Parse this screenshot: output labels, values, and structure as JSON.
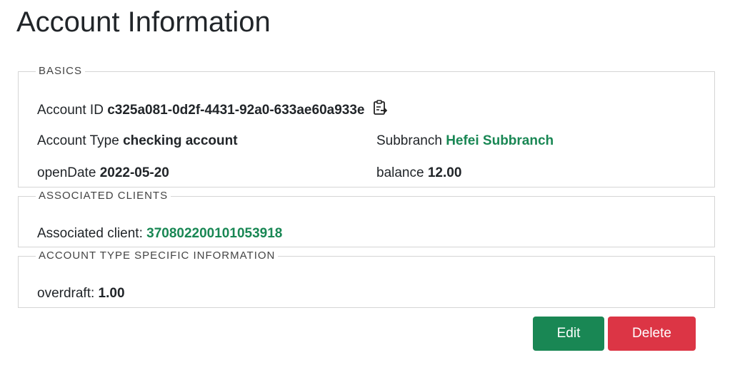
{
  "page_title": "Account Information",
  "basics": {
    "legend": "BASICS",
    "account_id_label": "Account ID",
    "account_id_value": "c325a081-0d2f-4431-92a0-633ae60a933e",
    "account_type_label": "Account Type",
    "account_type_value": "checking account",
    "subbranch_label": "Subbranch",
    "subbranch_value": "Hefei Subbranch",
    "open_date_label": "openDate",
    "open_date_value": "2022-05-20",
    "balance_label": "balance",
    "balance_value": "12.00"
  },
  "clients": {
    "legend": "ASSOCIATED CLIENTS",
    "label": "Associated client:",
    "value": "370802200101053918"
  },
  "specific": {
    "legend": "ACCOUNT TYPE SPECIFIC INFORMATION",
    "overdraft_label": "overdraft:",
    "overdraft_value": "1.00"
  },
  "actions": {
    "edit_label": "Edit",
    "delete_label": "Delete"
  },
  "icons": {
    "copy": "clipboard-copy-icon"
  },
  "colors": {
    "link": "#198754",
    "edit_button": "#198754",
    "delete_button": "#dc3545"
  }
}
